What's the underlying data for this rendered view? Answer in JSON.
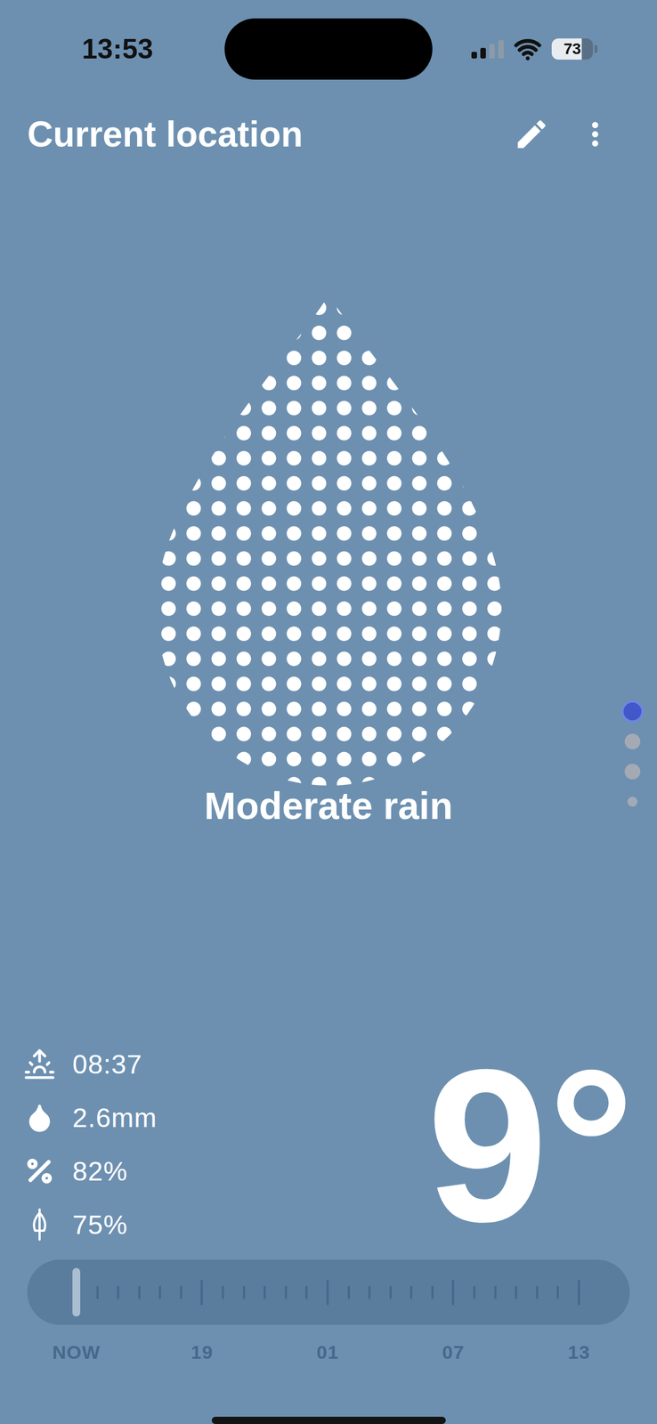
{
  "status_bar": {
    "time": "13:53",
    "signal": {
      "level": 0.5
    },
    "wifi": {
      "on": true
    },
    "battery": {
      "reading": "73",
      "level": 0.73
    }
  },
  "header": {
    "title": "Current location"
  },
  "condition": {
    "label": "Moderate rain"
  },
  "pages": [
    {
      "selected": true,
      "kind": "page"
    },
    {
      "selected": false,
      "kind": "page"
    },
    {
      "selected": false,
      "kind": "page"
    },
    {
      "selected": false,
      "kind": "overflow"
    }
  ],
  "stats": [
    {
      "kind": "sunrise",
      "value": "08:37"
    },
    {
      "kind": "precipitation",
      "value": "2.6mm"
    },
    {
      "kind": "humidity",
      "value": "82%"
    },
    {
      "kind": "rain-chance",
      "value": "75%"
    }
  ],
  "temperature": "9°",
  "timeline": {
    "level": 0,
    "labels": [
      "NOW",
      "19",
      "01",
      "07",
      "13"
    ]
  }
}
